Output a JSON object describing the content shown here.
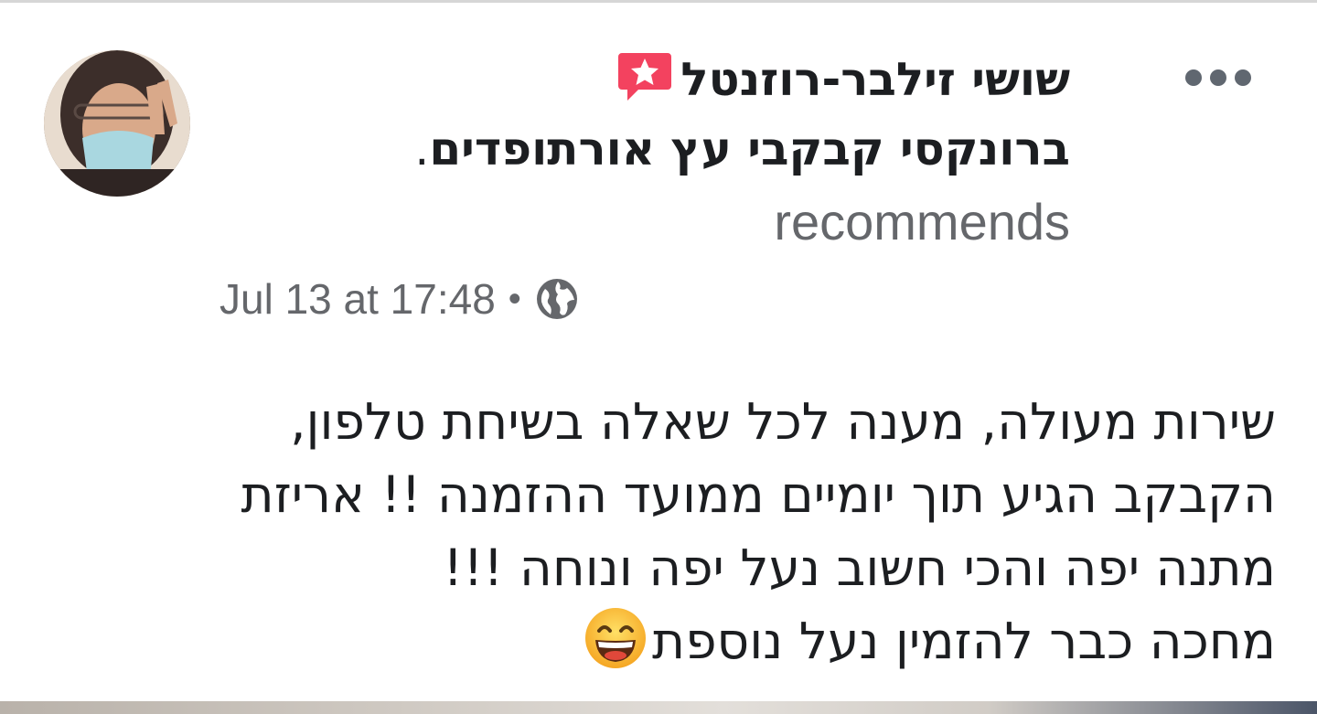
{
  "post": {
    "author_name": "שושי זילבר-רוזנטל",
    "recommends_verb": "recommends",
    "business_name": "ברונקסי קבקבי עץ אורתופדים",
    "period": ".",
    "timestamp": "Jul 13 at 17:48",
    "separator": "•",
    "privacy_icon": "globe-icon",
    "badge_icon": "recommendation-star-icon",
    "more_icon": "more-options-icon",
    "body_lines": [
      "שירות מעולה, מענה לכל שאלה בשיחת טלפון,",
      "הקבקב הגיע תוך יומיים ממועד ההזמנה !! אריזת",
      "מתנה יפה והכי חשוב נעל יפה ונוחה !!!",
      "מחכה כבר להזמין נעל נוספת"
    ],
    "trailing_emoji": "grinning-face-with-smiling-eyes",
    "colors": {
      "text_primary": "#1c1e21",
      "text_secondary": "#65676b",
      "badge": "#f3425f"
    }
  }
}
